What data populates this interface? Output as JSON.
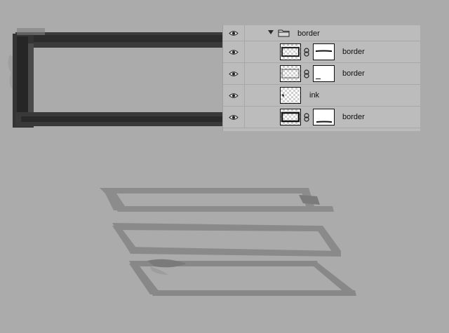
{
  "layers_panel": {
    "group": {
      "name": "border",
      "expanded": true,
      "icon": "folder-icon",
      "visible": true
    },
    "layers": [
      {
        "name": "border",
        "visible": true,
        "has_mask": true,
        "linked": true
      },
      {
        "name": "border",
        "visible": true,
        "has_mask": true,
        "linked": true
      },
      {
        "name": "ink",
        "visible": true,
        "has_mask": false,
        "linked": false
      },
      {
        "name": "border",
        "visible": true,
        "has_mask": true,
        "linked": true
      }
    ]
  },
  "colors": {
    "canvas_bg": "#ababab",
    "panel_bg": "#bcbcbc",
    "ink_dark": "#2e2e2e",
    "ink_mid": "#8a8a8a"
  }
}
